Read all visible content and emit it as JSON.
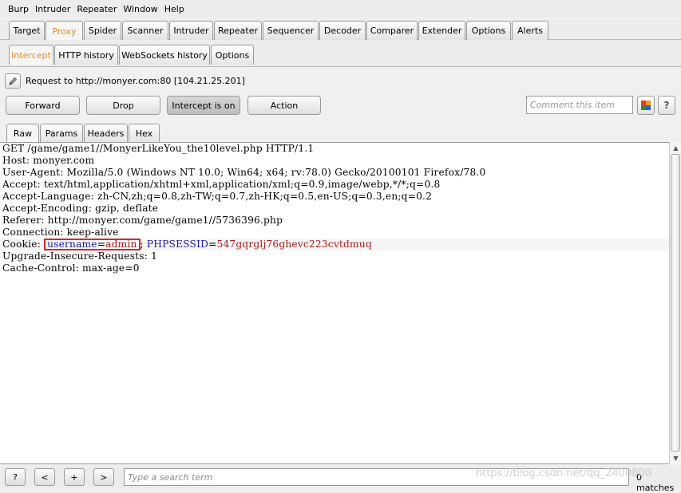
{
  "menu": [
    "Burp",
    "Intruder",
    "Repeater",
    "Window",
    "Help"
  ],
  "main_tabs": [
    "Target",
    "Proxy",
    "Spider",
    "Scanner",
    "Intruder",
    "Repeater",
    "Sequencer",
    "Decoder",
    "Comparer",
    "Extender",
    "Options",
    "Alerts"
  ],
  "proxy_tabs": [
    "Intercept",
    "HTTP history",
    "WebSockets history",
    "Options"
  ],
  "request_info": "Request to http://monyer.com:80  [104.21.25.201]",
  "buttons": {
    "forward": "Forward",
    "drop": "Drop",
    "intercept": "Intercept is on",
    "action": "Action"
  },
  "comment_placeholder": "Comment this item",
  "help_label": "?",
  "view_tabs": [
    "Raw",
    "Params",
    "Headers",
    "Hex"
  ],
  "request_lines": [
    "GET /game/game1//MonyerLikeYou_the10level.php HTTP/1.1",
    "Host: monyer.com",
    "User-Agent: Mozilla/5.0 (Windows NT 10.0; Win64; x64; rv:78.0) Gecko/20100101 Firefox/78.0",
    "Accept: text/html,application/xhtml+xml,application/xml;q=0.9,image/webp,*/*;q=0.8",
    "Accept-Language: zh-CN,zh;q=0.8,zh-TW;q=0.7,zh-HK;q=0.5,en-US;q=0.3,en;q=0.2",
    "Accept-Encoding: gzip, deflate",
    "Referer: http://monyer.com/game/game1//5736396.php",
    "Connection: keep-alive"
  ],
  "cookie": {
    "prefix": "Cookie: ",
    "k1": "username",
    "eq1": "=",
    "v1": "admin",
    "sep": "; ",
    "k2": "PHPSESSID",
    "eq2": "=",
    "v2": "547gqrglj76ghevc223cvtdmuq"
  },
  "request_lines_after": [
    "Upgrade-Insecure-Requests: 1",
    "Cache-Control: max-age=0"
  ],
  "bottom": {
    "help": "?",
    "prev": "<",
    "add": "+",
    "next": ">",
    "search_placeholder": "Type a search term",
    "matches": "0 matches"
  },
  "watermark": "https://blog.csdn.net/qq_2400800",
  "colors": {
    "accent": "#f28a1c",
    "cookie_key": "#1a1aa8",
    "cookie_value": "#b01818",
    "highlight_box": "#e22323"
  }
}
